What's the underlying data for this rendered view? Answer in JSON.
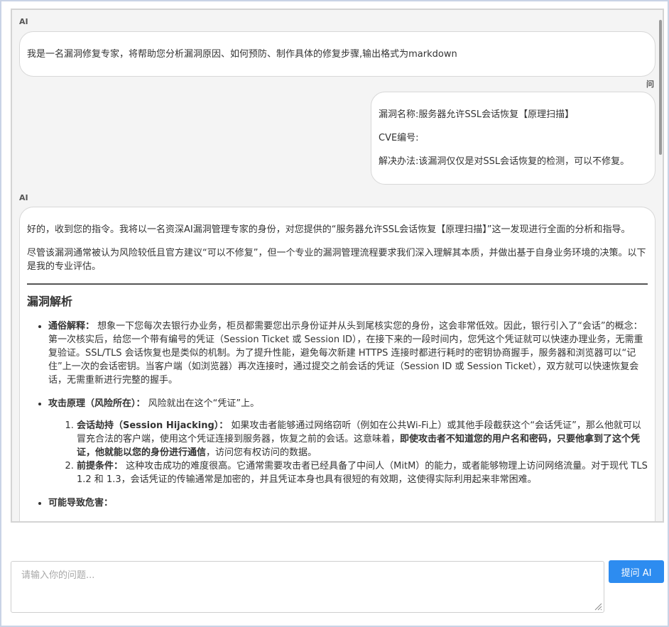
{
  "chat": {
    "ai_role_label": "AI",
    "user_role_label": "问",
    "messages": {
      "ai_intro": "我是一名漏洞修复专家，将帮助您分析漏洞原因、如何预防、制作具体的修复步骤,输出格式为markdown",
      "user_query": {
        "line1": "漏洞名称:服务器允许SSL会话恢复【原理扫描】",
        "line2": "CVE编号:",
        "line3": "解决办法:该漏洞仅仅是对SSL会话恢复的检测，可以不修复。"
      },
      "ai_reply": {
        "p1": "好的，收到您的指令。我将以一名资深AI漏洞管理专家的身份，对您提供的“服务器允许SSL会话恢复【原理扫描】”这一发现进行全面的分析和指导。",
        "p2": "尽管该漏洞通常被认为风险较低且官方建议“可以不修复”，但一个专业的漏洞管理流程要求我们深入理解其本质，并做出基于自身业务环境的决策。以下是我的专业评估。",
        "heading": "漏洞解析",
        "bullet1_label": "通俗解释：",
        "bullet1_text": " 想象一下您每次去银行办业务，柜员都需要您出示身份证并从头到尾核实您的身份，这会非常低效。因此，银行引入了“会话”的概念：第一次核实后，给您一个带有编号的凭证（Session Ticket 或 Session ID），在接下来的一段时间内，您凭这个凭证就可以快速办理业务，无需重复验证。SSL/TLS 会话恢复也是类似的机制。为了提升性能，避免每次新建 HTTPS 连接时都进行耗时的密钥协商握手，服务器和浏览器可以“记住”上一次的会话密钥。当客户端（如浏览器）再次连接时，通过提交之前会话的凭证（Session ID 或 Session Ticket），双方就可以快速恢复会话，无需重新进行完整的握手。",
        "bullet2_label": "攻击原理（风险所在）：",
        "bullet2_text": " 风险就出在这个“凭证”上。",
        "sub1_label": "会话劫持（Session Hijacking）：",
        "sub1_text": " 如果攻击者能够通过网络窃听（例如在公共Wi-Fi上）或其他手段截获这个“会话凭证”，那么他就可以冒充合法的客户端，使用这个凭证连接到服务器，恢复之前的会话。这意味着，",
        "sub1_bold": "即使攻击者不知道您的用户名和密码，只要他拿到了这个凭证，他就能以您的身份进行通信",
        "sub1_tail": "，访问您有权访问的数据。",
        "sub2_label": "前提条件：",
        "sub2_text": " 这种攻击成功的难度很高。它通常需要攻击者已经具备了中间人（MitM）的能力，或者能够物理上访问网络流量。对于现代 TLS 1.2 和 1.3，会话凭证的传输通常是加密的，并且凭证本身也具有很短的有效期，这使得实际利用起来非常困难。",
        "bullet3_label": "可能导致危害："
      }
    }
  },
  "composer": {
    "placeholder": "请输入你的问题...",
    "submit_label": "提问 AI"
  }
}
